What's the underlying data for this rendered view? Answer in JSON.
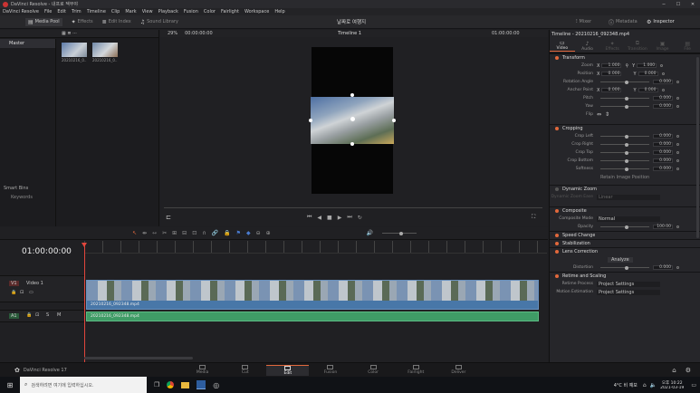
{
  "window": {
    "title": "DaVinci Resolve - 내프로 젝무야"
  },
  "menu": [
    "DaVinci Resolve",
    "File",
    "Edit",
    "Trim",
    "Timeline",
    "Clip",
    "Mark",
    "View",
    "Playback",
    "Fusion",
    "Color",
    "Fairlight",
    "Workspace",
    "Help"
  ],
  "toolbar": {
    "media_pool": "Media Pool",
    "effects": "Effects",
    "edit_index": "Edit Index",
    "sound_library": "Sound Library",
    "project_title": "날짜로 여행지",
    "mixer": "Mixer",
    "metadata": "Metadata",
    "inspector": "Inspector"
  },
  "media_pool": {
    "bin_label": "Master",
    "clips": [
      {
        "name": "20210216_0...",
        "thumb_color": "#6d8fbf"
      },
      {
        "name": "20210216_0...",
        "thumb_color": "#7b93ad"
      }
    ],
    "smart_bins": "Smart Bins",
    "keywords": "Keywords"
  },
  "viewer": {
    "zoom": "29%",
    "source_timecode": "00:00:00:00",
    "timeline_name": "Timeline 1",
    "timecode": "01:00:00:00"
  },
  "timeline": {
    "timecode": "01:00:00:00",
    "video_track": {
      "id": "V1",
      "name": "Video 1"
    },
    "audio_track": {
      "id": "A1"
    },
    "video_clip": "20210216_092348.mp4",
    "audio_clip": "20210216_092348.mp4"
  },
  "inspector": {
    "clip_title": "Timeline - 20210216_092348.mp4",
    "tabs": [
      "Video",
      "Audio",
      "Effects",
      "Transition",
      "Image",
      "File"
    ],
    "transform": {
      "title": "Transform",
      "rows": [
        {
          "label": "Zoom",
          "x": "1.000",
          "y": "1.000",
          "x_label": "X",
          "y_label": "Y"
        },
        {
          "label": "Position",
          "x": "0.000",
          "y": "0.000",
          "x_label": "X",
          "y_label": "Y"
        },
        {
          "label": "Rotation Angle",
          "value": "0.000"
        },
        {
          "label": "Anchor Point",
          "x": "0.000",
          "y": "0.000",
          "x_label": "X",
          "y_label": "Y"
        },
        {
          "label": "Pitch",
          "value": "0.000"
        },
        {
          "label": "Yaw",
          "value": "0.000"
        }
      ],
      "flip_label": "Flip"
    },
    "cropping": {
      "title": "Cropping",
      "rows": [
        {
          "label": "Crop Left",
          "value": "0.000"
        },
        {
          "label": "Crop Right",
          "value": "0.000"
        },
        {
          "label": "Crop Top",
          "value": "0.000"
        },
        {
          "label": "Crop Bottom",
          "value": "0.000"
        },
        {
          "label": "Softness",
          "value": "0.000"
        }
      ],
      "retain": "Retain Image Position"
    },
    "dynamic_zoom": {
      "title": "Dynamic Zoom",
      "ease_label": "Dynamic Zoom Ease",
      "ease_value": "Linear"
    },
    "composite": {
      "title": "Composite",
      "mode_label": "Composite Mode",
      "mode_value": "Normal",
      "opacity_label": "Opacity",
      "opacity_value": "100.00"
    },
    "speed_change": "Speed Change",
    "stabilization": "Stabilization",
    "lens_correction": {
      "title": "Lens Correction",
      "analyze": "Analyze",
      "distortion_label": "Distortion",
      "distortion_value": "0.000"
    },
    "retime_scaling": {
      "title": "Retime and Scaling",
      "retime_label": "Retime Process",
      "retime_value": "Project Settings",
      "motion_label": "Motion Estimation",
      "motion_value": "Project Settings"
    }
  },
  "pages": {
    "app": "DaVinci Resolve 17",
    "tabs": [
      "Media",
      "Cut",
      "Edit",
      "Fusion",
      "Color",
      "Fairlight",
      "Deliver"
    ],
    "active": "Edit"
  },
  "taskbar": {
    "search_placeholder": "검색하려면 여기에 입력하십시오.",
    "time": "오후 10:22",
    "date": "2021-03-19",
    "temp": "4°C 비 예보"
  },
  "colors": {
    "accent": "#e2683c",
    "video_clip": "#4877a8",
    "audio_clip": "#3f9c66",
    "playhead": "#e2463c"
  }
}
